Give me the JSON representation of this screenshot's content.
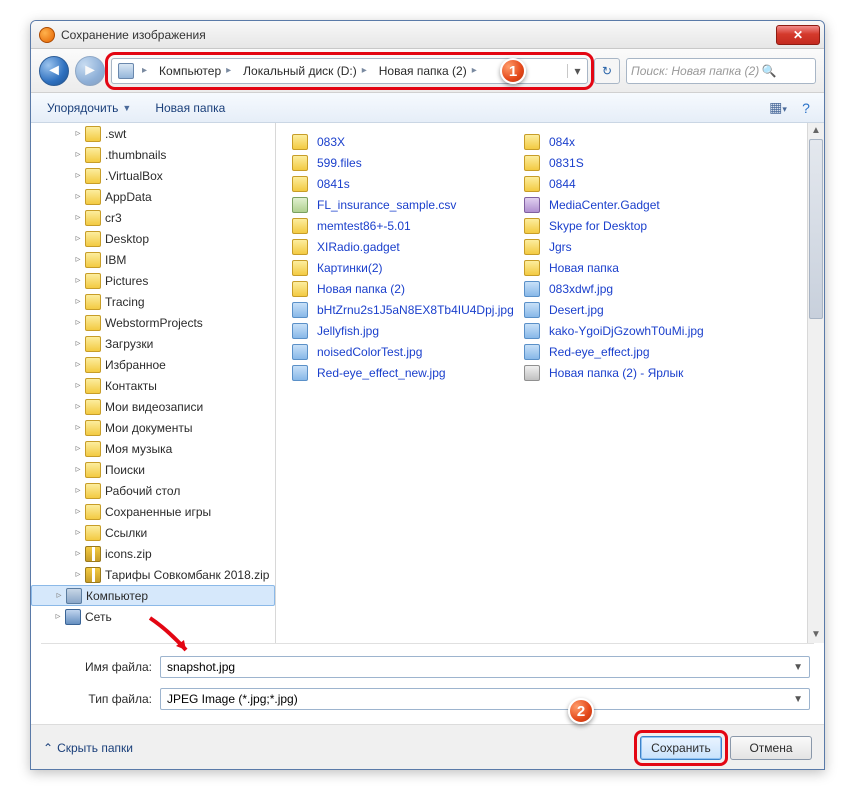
{
  "title": "Сохранение изображения",
  "breadcrumbs": [
    "Компьютер",
    "Локальный диск (D:)",
    "Новая папка (2)"
  ],
  "search_placeholder": "Поиск: Новая папка (2)",
  "toolbar": {
    "organize": "Упорядочить",
    "new_folder": "Новая папка"
  },
  "tree": [
    {
      "label": ".swt",
      "icon": "ic-folder",
      "ind": 1
    },
    {
      "label": ".thumbnails",
      "icon": "ic-folder",
      "ind": 1
    },
    {
      "label": ".VirtualBox",
      "icon": "ic-folder",
      "ind": 1
    },
    {
      "label": "AppData",
      "icon": "ic-folder",
      "ind": 1
    },
    {
      "label": "cr3",
      "icon": "ic-folder",
      "ind": 1
    },
    {
      "label": "Desktop",
      "icon": "ic-folder",
      "ind": 1
    },
    {
      "label": "IBM",
      "icon": "ic-folder",
      "ind": 1
    },
    {
      "label": "Pictures",
      "icon": "ic-folder",
      "ind": 1
    },
    {
      "label": "Tracing",
      "icon": "ic-folder",
      "ind": 1
    },
    {
      "label": "WebstormProjects",
      "icon": "ic-folder",
      "ind": 1
    },
    {
      "label": "Загрузки",
      "icon": "ic-folder",
      "ind": 1
    },
    {
      "label": "Избранное",
      "icon": "ic-folder",
      "ind": 1
    },
    {
      "label": "Контакты",
      "icon": "ic-folder",
      "ind": 1
    },
    {
      "label": "Мои видеозаписи",
      "icon": "ic-folder",
      "ind": 1
    },
    {
      "label": "Мои документы",
      "icon": "ic-folder",
      "ind": 1
    },
    {
      "label": "Моя музыка",
      "icon": "ic-folder",
      "ind": 1
    },
    {
      "label": "Поиски",
      "icon": "ic-folder",
      "ind": 1
    },
    {
      "label": "Рабочий стол",
      "icon": "ic-folder",
      "ind": 1
    },
    {
      "label": "Сохраненные игры",
      "icon": "ic-folder",
      "ind": 1
    },
    {
      "label": "Ссылки",
      "icon": "ic-folder",
      "ind": 1
    },
    {
      "label": "icons.zip",
      "icon": "ic-zip",
      "ind": 1
    },
    {
      "label": "Тарифы Совкомбанк 2018.zip",
      "icon": "ic-zip",
      "ind": 1
    },
    {
      "label": "Компьютер",
      "icon": "ic-comp",
      "ind": 0,
      "sel": true
    },
    {
      "label": "Сеть",
      "icon": "ic-net",
      "ind": 0
    }
  ],
  "list_col1": [
    {
      "label": "083X",
      "icon": "ic-folder"
    },
    {
      "label": "599.files",
      "icon": "ic-folder"
    },
    {
      "label": "0841s",
      "icon": "ic-folder"
    },
    {
      "label": "FL_insurance_sample.csv",
      "icon": "ic-csv"
    },
    {
      "label": "memtest86+-5.01",
      "icon": "ic-folder"
    },
    {
      "label": "XIRadio.gadget",
      "icon": "ic-folder"
    },
    {
      "label": "Картинки(2)",
      "icon": "ic-folder"
    },
    {
      "label": "Новая папка (2)",
      "icon": "ic-folder"
    },
    {
      "label": "bHtZrnu2s1J5aN8EX8Tb4IU4Dpj.jpg",
      "icon": "ic-img"
    },
    {
      "label": "Jellyfish.jpg",
      "icon": "ic-img"
    },
    {
      "label": "noisedColorTest.jpg",
      "icon": "ic-img"
    },
    {
      "label": "Red-eye_effect_new.jpg",
      "icon": "ic-img"
    }
  ],
  "list_col2": [
    {
      "label": "084x",
      "icon": "ic-folder"
    },
    {
      "label": "0831S",
      "icon": "ic-folder"
    },
    {
      "label": "0844",
      "icon": "ic-folder"
    },
    {
      "label": "MediaCenter.Gadget",
      "icon": "ic-gadget"
    },
    {
      "label": "Skype for Desktop",
      "icon": "ic-folder"
    },
    {
      "label": "Jgrs",
      "icon": "ic-folder"
    },
    {
      "label": "Новая папка",
      "icon": "ic-folder"
    },
    {
      "label": "083xdwf.jpg",
      "icon": "ic-img"
    },
    {
      "label": "Desert.jpg",
      "icon": "ic-img"
    },
    {
      "label": "kako-YgoiDjGzowhT0uMi.jpg",
      "icon": "ic-img"
    },
    {
      "label": "Red-eye_effect.jpg",
      "icon": "ic-img"
    },
    {
      "label": "Новая папка (2) - Ярлык",
      "icon": "ic-link"
    }
  ],
  "fields": {
    "filename_label": "Имя файла:",
    "filename_value": "snapshot.jpg",
    "filetype_label": "Тип файла:",
    "filetype_value": "JPEG Image (*.jpg;*.jpg)"
  },
  "footer": {
    "hide_folders": "Скрыть папки",
    "save": "Сохранить",
    "cancel": "Отмена"
  },
  "callouts": {
    "one": "1",
    "two": "2"
  }
}
